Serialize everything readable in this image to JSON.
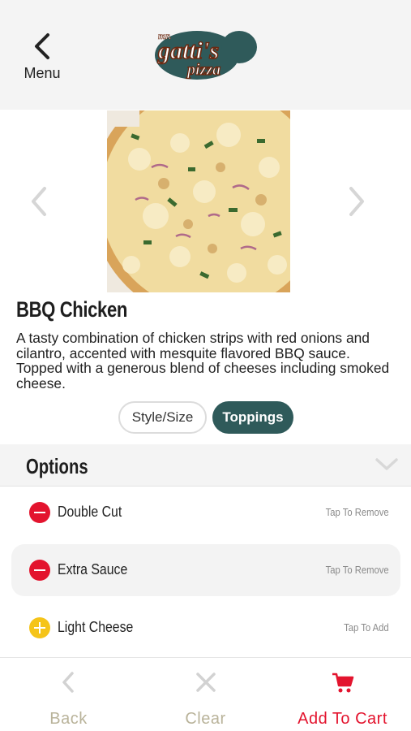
{
  "header": {
    "back_label": "Menu",
    "logo_text_top": "mr.",
    "logo_text_main": "gatti's",
    "logo_text_sub": "pizza"
  },
  "product": {
    "name": "BBQ Chicken",
    "description": "A tasty combination of chicken strips with red onions and cilantro, accented with mesquite flavored BBQ sauce. Topped with a generous blend of cheeses including smoked cheese."
  },
  "segments": {
    "style_size": "Style/Size",
    "toppings": "Toppings",
    "selected": "Toppings"
  },
  "options": {
    "title": "Options",
    "items": [
      {
        "name": "Double Cut",
        "action": "Tap To Remove",
        "state": "remove"
      },
      {
        "name": "Extra Sauce",
        "action": "Tap To Remove",
        "state": "remove"
      },
      {
        "name": "Light Cheese",
        "action": "Tap To Add",
        "state": "add"
      }
    ]
  },
  "footer": {
    "back": "Back",
    "clear": "Clear",
    "add_to_cart": "Add To Cart"
  },
  "colors": {
    "accent_teal": "#2f5a5a",
    "remove_red": "#e3142e",
    "add_yellow": "#f5c419",
    "muted_khaki": "#b9b39a"
  }
}
